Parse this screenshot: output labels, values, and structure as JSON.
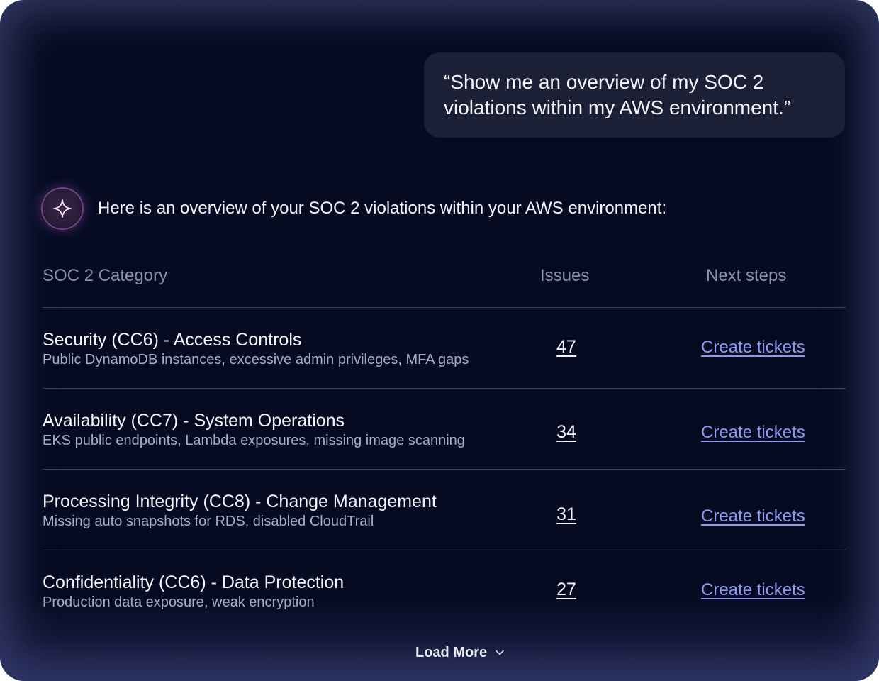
{
  "user_message": {
    "line1": "“Show me an overview of my SOC 2",
    "line2": "violations within my AWS environment.”"
  },
  "assistant": {
    "avatar_icon": "sparkle-icon",
    "message": "Here is an overview of your SOC 2 violations within your AWS environment:"
  },
  "table": {
    "headers": {
      "category": "SOC 2 Category",
      "issues": "Issues",
      "next_steps": "Next steps"
    },
    "rows": [
      {
        "title": "Security (CC6) - Access Controls",
        "description": "Public DynamoDB instances, excessive admin privileges, MFA gaps",
        "issues": "47",
        "action": "Create tickets"
      },
      {
        "title": "Availability (CC7) - System Operations",
        "description": "EKS public endpoints, Lambda exposures, missing image scanning",
        "issues": "34",
        "action": "Create tickets"
      },
      {
        "title": "Processing Integrity (CC8) - Change Management",
        "description": "Missing auto snapshots for RDS, disabled CloudTrail",
        "issues": "31",
        "action": "Create tickets"
      },
      {
        "title": "Confidentiality (CC6) - Data Protection",
        "description": "Production data exposure, weak encryption",
        "issues": "27",
        "action": "Create tickets"
      }
    ]
  },
  "load_more": {
    "label": "Load More",
    "icon": "chevron-down-icon"
  },
  "colors": {
    "background": "#060b22",
    "bubble": "#1c2036",
    "link": "#8e98f0",
    "muted": "#8b8fa8"
  }
}
